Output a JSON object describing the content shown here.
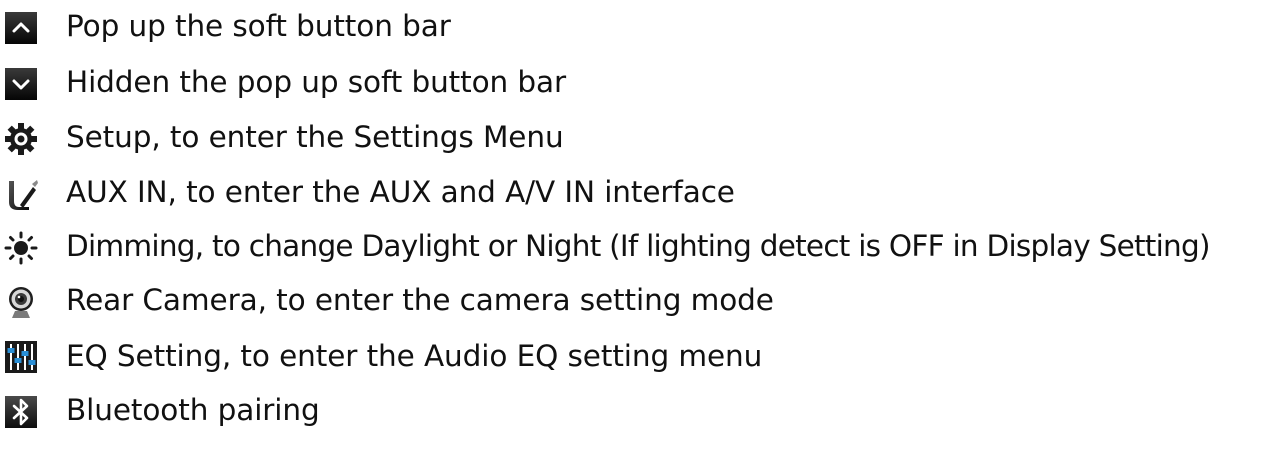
{
  "legend": {
    "items": [
      {
        "icon": "chevron-up-icon",
        "label": "Pop up the soft button bar"
      },
      {
        "icon": "chevron-down-icon",
        "label": "Hidden the pop up soft button bar"
      },
      {
        "icon": "gear-icon",
        "label": "Setup, to enter the Settings Menu"
      },
      {
        "icon": "aux-cable-icon",
        "label": "AUX IN, to enter the AUX and A/V IN interface"
      },
      {
        "icon": "sun-icon",
        "label": "Dimming, to change Daylight or Night (If lighting detect is OFF in Display Setting)"
      },
      {
        "icon": "webcam-icon",
        "label": "Rear Camera, to enter the camera setting mode"
      },
      {
        "icon": "equalizer-icon",
        "label": "EQ Setting, to enter the Audio EQ setting menu"
      },
      {
        "icon": "bluetooth-icon",
        "label": "Bluetooth pairing"
      }
    ]
  }
}
